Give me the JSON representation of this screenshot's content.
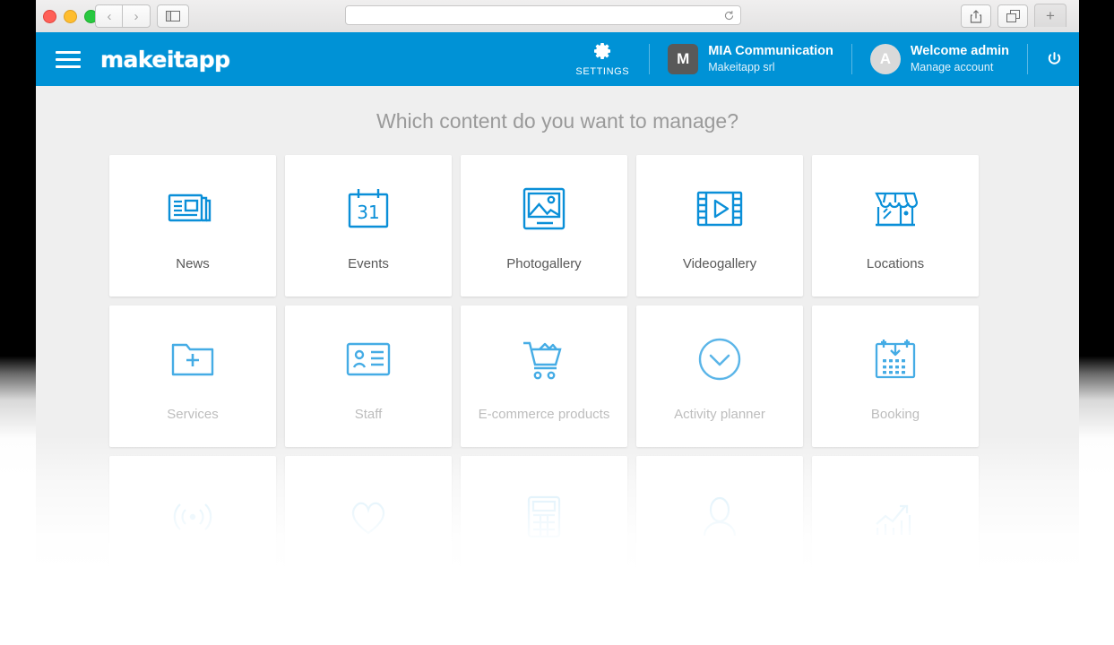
{
  "browser": {
    "window_controls": [
      "close",
      "minimize",
      "zoom"
    ],
    "back_label": "‹",
    "forward_label": "›",
    "sidebar_icon": "sidebar-icon",
    "url_value": "",
    "url_placeholder": "",
    "reload_icon": "reload-icon",
    "share_icon": "share-icon",
    "tabs_icon": "tab-overview-icon",
    "newtab_label": "+"
  },
  "header": {
    "menu_icon": "hamburger-icon",
    "logo": "makeitapp",
    "settings": {
      "icon": "gear-icon",
      "label": "SETTINGS"
    },
    "organization": {
      "avatar": "M",
      "name": "MIA Communication",
      "subtitle": "Makeitapp srl"
    },
    "account": {
      "avatar": "A",
      "name": "Welcome admin",
      "subtitle": "Manage account"
    },
    "power": {
      "icon": "power-icon",
      "label": ""
    },
    "accent_color": "#0092d6",
    "org_avatar_color": "#595959",
    "user_avatar_color": "#d9d9d9"
  },
  "main": {
    "title": "Which content do you want to manage?",
    "icon_color": "#0a8fd8",
    "tiles": [
      {
        "label": "News",
        "icon": "newspaper-icon",
        "state": "enabled"
      },
      {
        "label": "Events",
        "icon": "calendar-31-icon",
        "state": "enabled"
      },
      {
        "label": "Photogallery",
        "icon": "photo-icon",
        "state": "enabled"
      },
      {
        "label": "Videogallery",
        "icon": "film-play-icon",
        "state": "enabled"
      },
      {
        "label": "Locations",
        "icon": "storefront-icon",
        "state": "enabled"
      },
      {
        "label": "Services",
        "icon": "folder-plus-icon",
        "state": "disabled"
      },
      {
        "label": "Staff",
        "icon": "id-card-icon",
        "state": "disabled"
      },
      {
        "label": "E-commerce products",
        "icon": "shopping-cart-icon",
        "state": "disabled"
      },
      {
        "label": "Activity planner",
        "icon": "clock-icon",
        "state": "disabled"
      },
      {
        "label": "Booking",
        "icon": "calendar-download-icon",
        "state": "disabled"
      },
      {
        "label": "",
        "icon": "beacon-icon",
        "state": "faded"
      },
      {
        "label": "",
        "icon": "heart-icon",
        "state": "faded"
      },
      {
        "label": "",
        "icon": "calculator-icon",
        "state": "faded"
      },
      {
        "label": "",
        "icon": "person-icon",
        "state": "faded"
      },
      {
        "label": "",
        "icon": "chart-arrow-icon",
        "state": "faded"
      }
    ]
  }
}
